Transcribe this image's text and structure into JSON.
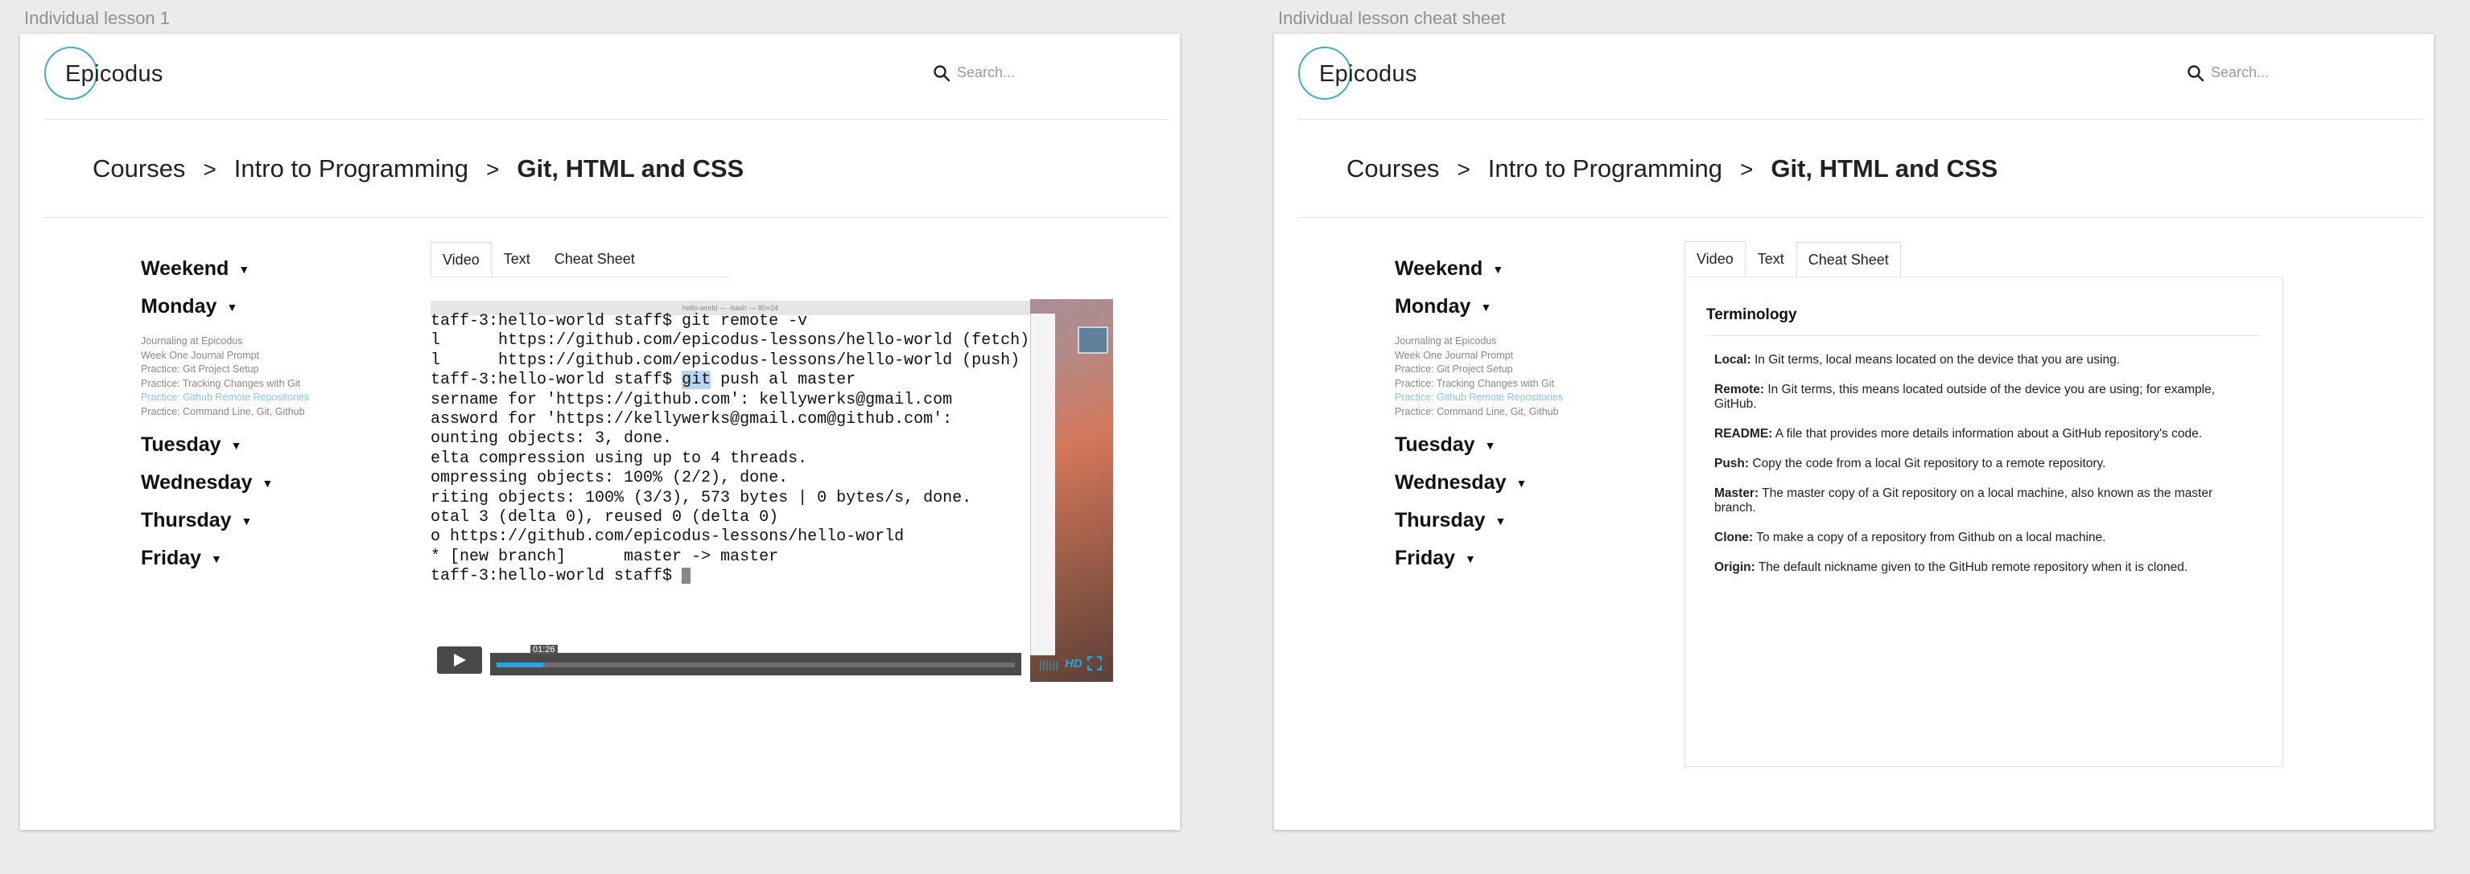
{
  "frames": [
    {
      "label": "Individual lesson 1"
    },
    {
      "label": "Individual lesson cheat sheet"
    }
  ],
  "header": {
    "logo_text": "Epicodus",
    "search_placeholder": "Search..."
  },
  "breadcrumb": {
    "items": [
      "Courses",
      "Intro to Programming",
      "Git, HTML and CSS"
    ],
    "separator": ">"
  },
  "sidebar": {
    "days": [
      "Weekend",
      "Monday",
      "Tuesday",
      "Wednesday",
      "Thursday",
      "Friday"
    ],
    "monday_lessons": [
      "Journaling at Epicodus",
      "Week One Journal Prompt",
      "Practice: Git Project Setup",
      "Practice: Tracking Changes with Git",
      "Practice: Github Remote Repositories",
      "Practice: Command Line, Git, Github"
    ],
    "active_lesson": "Practice: Github Remote Repositories"
  },
  "tabs": [
    "Video",
    "Text",
    "Cheat Sheet"
  ],
  "video": {
    "window_title": "hello-world — -bash — 80×24",
    "terminal_lines": [
      "taff-3:hello-world staff$ git remote -v",
      "l      https://github.com/epicodus-lessons/hello-world (fetch)",
      "l      https://github.com/epicodus-lessons/hello-world (push)",
      "sername for 'https://github.com': kellywerks@gmail.com",
      "assword for 'https://kellywerks@gmail.com@github.com':",
      "ounting objects: 3, done.",
      "elta compression using up to 4 threads.",
      "ompressing objects: 100% (2/2), done.",
      "riting objects: 100% (3/3), 573 bytes | 0 bytes/s, done.",
      "otal 3 (delta 0), reused 0 (delta 0)",
      "o https://github.com/epicodus-lessons/hello-world",
      "* [new branch]      master -> master",
      "taff-3:hello-world staff$ "
    ],
    "push_prompt": "taff-3:hello-world staff$ ",
    "push_highlight": "git",
    "push_rest": " push al master",
    "current_time": "01:26",
    "progress": 0.09,
    "hd_label": "HD"
  },
  "cheat_sheet": {
    "heading": "Terminology",
    "terms": [
      {
        "term": "Local:",
        "def": " In Git terms, local means located on the device that you are using."
      },
      {
        "term": "Remote:",
        "def": " In Git terms, this means located outside of the device you are using; for example, GitHub."
      },
      {
        "term": "README:",
        "def": " A file that provides more details information about a GitHub repository's code."
      },
      {
        "term": "Push:",
        "def": " Copy the code from a local Git repository to a remote repository."
      },
      {
        "term": "Master:",
        "def": " The master copy of a Git repository on a local machine, also known as the master branch."
      },
      {
        "term": "Clone:",
        "def": " To make a copy of a repository from Github on a local machine."
      },
      {
        "term": "Origin:",
        "def": " The default nickname given to the GitHub remote repository when it is cloned."
      }
    ]
  },
  "colors": {
    "accent": "#3fb0c3",
    "active_lesson": "#86cad6",
    "player_accent": "#2aa4e0"
  }
}
